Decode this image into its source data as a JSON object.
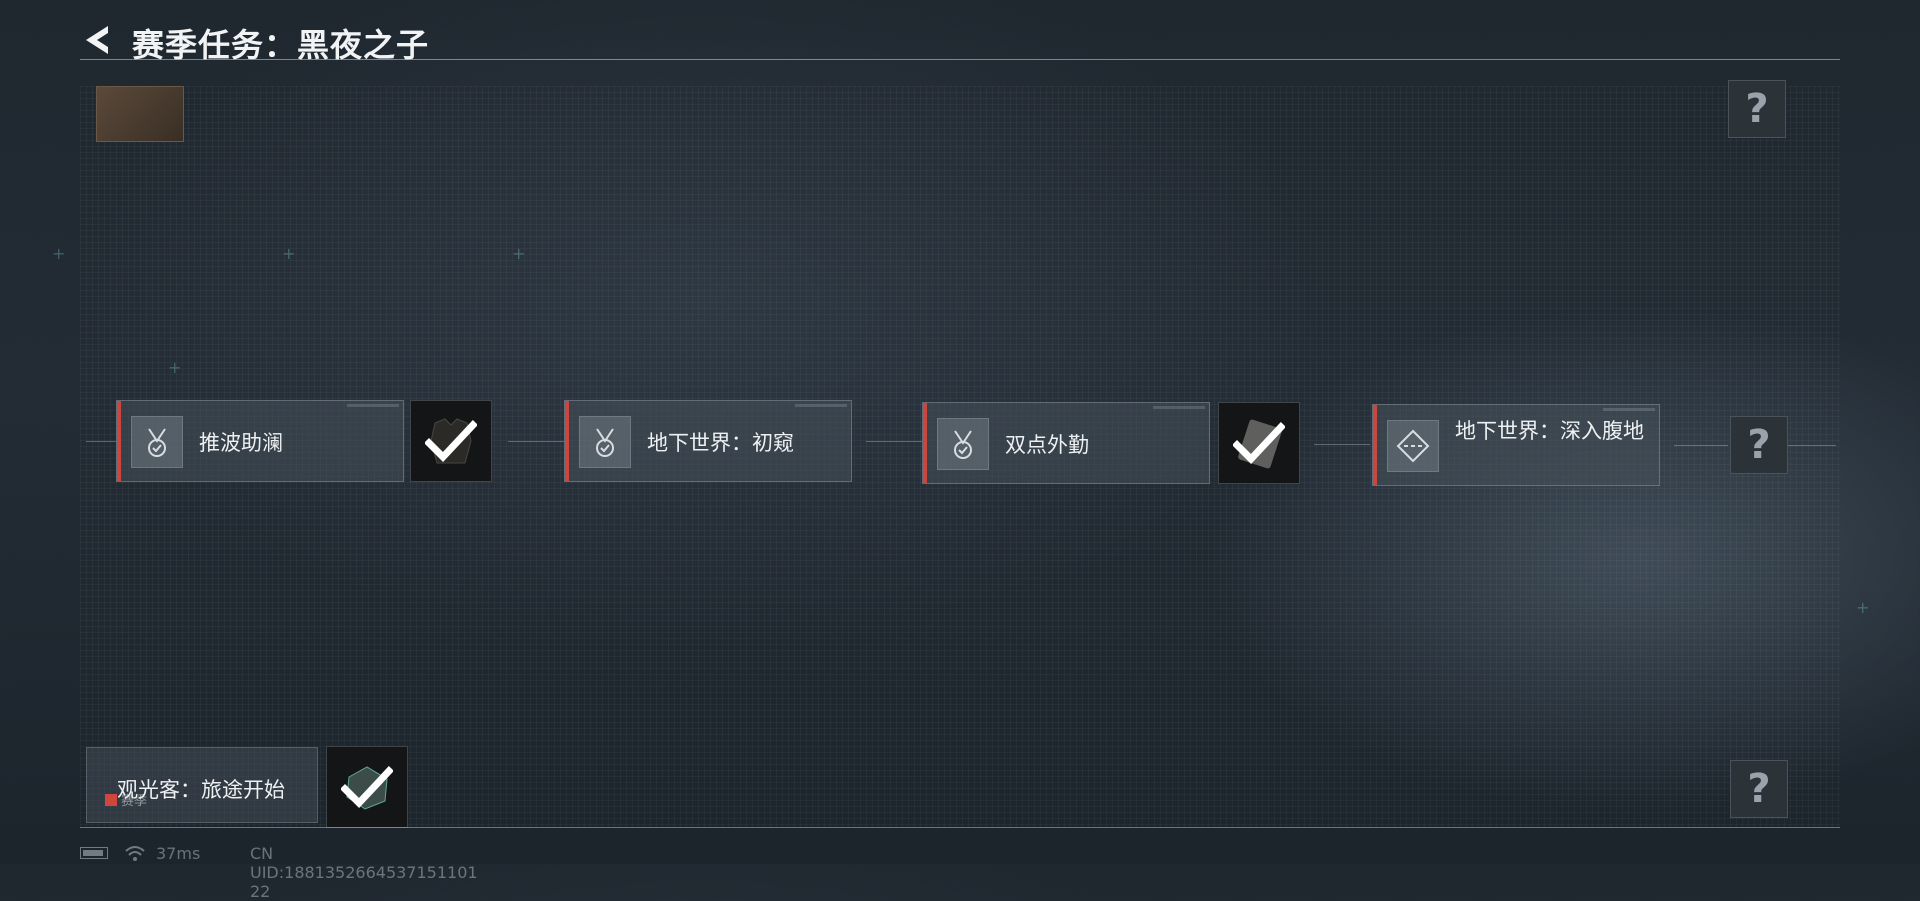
{
  "header": {
    "title": "赛季任务：黑夜之子"
  },
  "quests": [
    {
      "label": "推波助澜"
    },
    {
      "label": "地下世界：初窥"
    },
    {
      "label": "双点外勤"
    },
    {
      "label": "地下世界：深入腹地"
    }
  ],
  "unknown_nodes": [
    {
      "symbol": "?"
    },
    {
      "symbol": "?"
    },
    {
      "symbol": "?"
    }
  ],
  "bottom_quest": {
    "label": "观光客：旅途开始",
    "tag": "赛季"
  },
  "status_bar": {
    "ping": "37ms",
    "uid": "CN UID:1881352664537151101 22"
  },
  "colors": {
    "accent_red": "#c9473f",
    "check": "#ffffff"
  }
}
